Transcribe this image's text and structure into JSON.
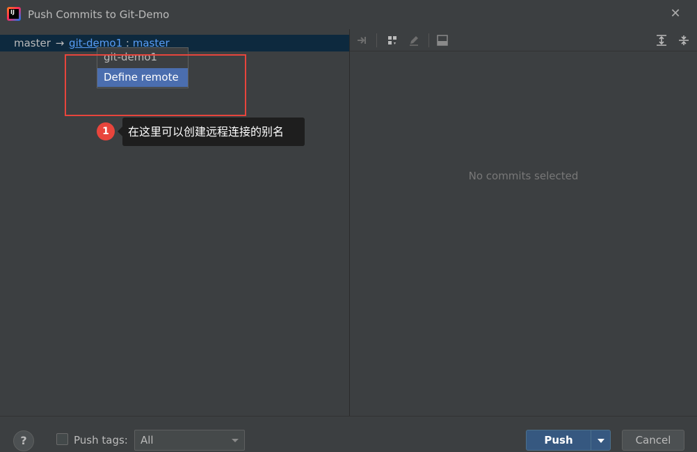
{
  "window": {
    "title": "Push Commits to Git-Demo"
  },
  "branch": {
    "source": "master",
    "arrow": "→",
    "remote": "git-demo1",
    "separator": ":",
    "target": "master"
  },
  "popup": {
    "items": [
      "git-demo1",
      "Define remote"
    ],
    "selected_index": 1
  },
  "annotation": {
    "number": "1",
    "text": "在这里可以创建远程连接的别名",
    "color": "#e8453c"
  },
  "details": {
    "empty_text": "No commits selected"
  },
  "footer": {
    "help_label": "?",
    "push_tags_label": "Push tags:",
    "push_tags_checked": false,
    "tags_selected": "All",
    "push_label": "Push",
    "cancel_label": "Cancel"
  },
  "colors": {
    "background": "#3c3f41",
    "selection": "#4b6eaf",
    "branch_row": "#0d293e",
    "link": "#589df6",
    "push_button": "#365880"
  }
}
